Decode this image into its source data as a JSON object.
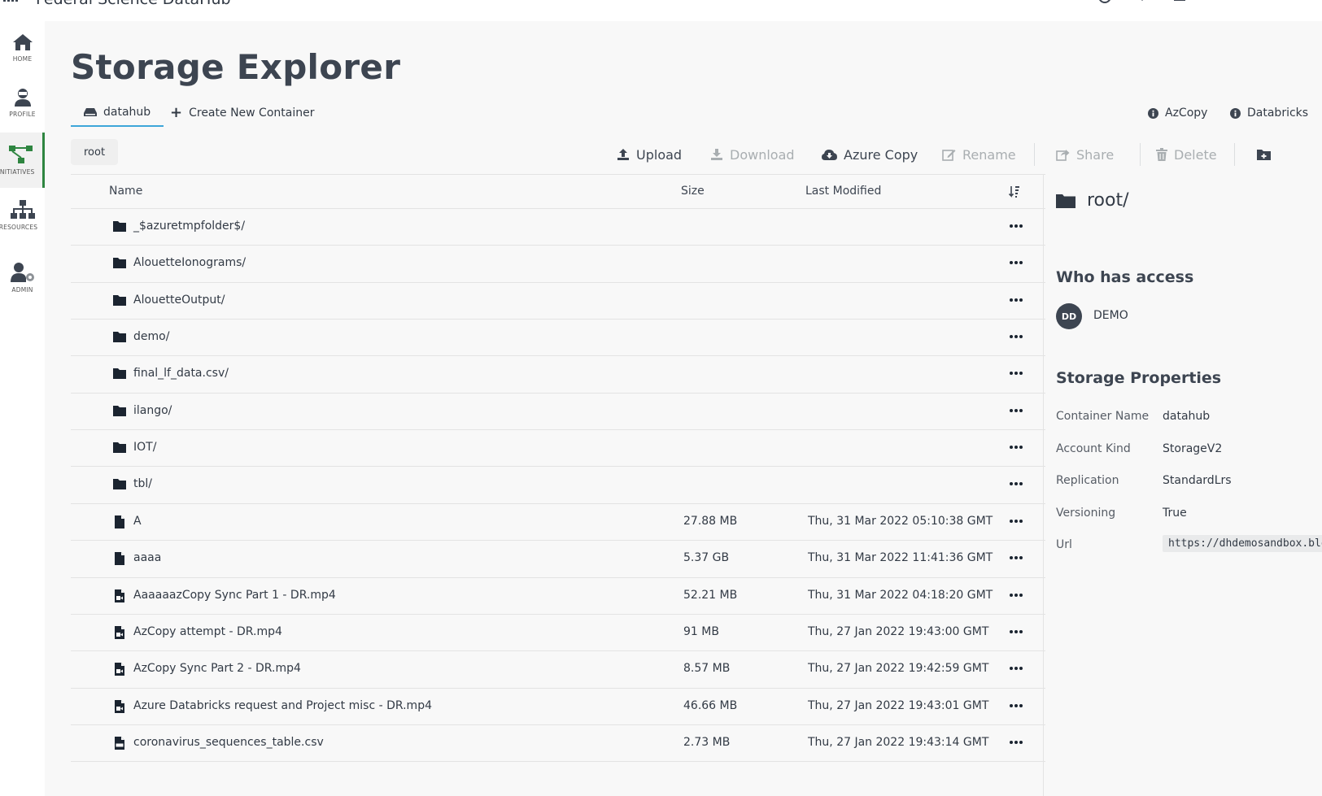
{
  "app": {
    "title": "Federal Science DataHub"
  },
  "sidebar": {
    "items": [
      {
        "label": "HOME"
      },
      {
        "label": "PROFILE"
      },
      {
        "label": "INITIATIVES"
      },
      {
        "label": "RESOURCES"
      },
      {
        "label": "ADMIN"
      }
    ],
    "active_index": 2
  },
  "page": {
    "title": "Storage Explorer"
  },
  "tabs": {
    "container": "datahub",
    "create": "Create New Container",
    "azcopy": "AzCopy",
    "databricks": "Databricks"
  },
  "breadcrumb": {
    "path": "root"
  },
  "toolbar": {
    "upload": "Upload",
    "download": "Download",
    "azure_copy": "Azure Copy",
    "rename": "Rename",
    "share": "Share",
    "delete": "Delete"
  },
  "table": {
    "columns": {
      "name": "Name",
      "size": "Size",
      "modified": "Last Modified"
    },
    "rows": [
      {
        "type": "folder",
        "name": "_$azuretmpfolder$/",
        "size": "",
        "modified": ""
      },
      {
        "type": "folder",
        "name": "AlouetteIonograms/",
        "size": "",
        "modified": ""
      },
      {
        "type": "folder",
        "name": "AlouetteOutput/",
        "size": "",
        "modified": ""
      },
      {
        "type": "folder",
        "name": "demo/",
        "size": "",
        "modified": ""
      },
      {
        "type": "folder",
        "name": "final_lf_data.csv/",
        "size": "",
        "modified": ""
      },
      {
        "type": "folder",
        "name": "ilango/",
        "size": "",
        "modified": ""
      },
      {
        "type": "folder",
        "name": "IOT/",
        "size": "",
        "modified": ""
      },
      {
        "type": "folder",
        "name": "tbl/",
        "size": "",
        "modified": ""
      },
      {
        "type": "file",
        "name": "A",
        "size": "27.88 MB",
        "modified": "Thu, 31 Mar 2022 05:10:38 GMT"
      },
      {
        "type": "file",
        "name": "aaaa",
        "size": "5.37 GB",
        "modified": "Thu, 31 Mar 2022 11:41:36 GMT"
      },
      {
        "type": "video",
        "name": "AaaaaazCopy Sync Part 1 - DR.mp4",
        "size": "52.21 MB",
        "modified": "Thu, 31 Mar 2022 04:18:20 GMT"
      },
      {
        "type": "video",
        "name": "AzCopy attempt - DR.mp4",
        "size": "91 MB",
        "modified": "Thu, 27 Jan 2022 19:43:00 GMT"
      },
      {
        "type": "video",
        "name": "AzCopy Sync Part 2 - DR.mp4",
        "size": "8.57 MB",
        "modified": "Thu, 27 Jan 2022 19:42:59 GMT"
      },
      {
        "type": "video",
        "name": "Azure Databricks request and Project misc - DR.mp4",
        "size": "46.66 MB",
        "modified": "Thu, 27 Jan 2022 19:43:01 GMT"
      },
      {
        "type": "csv",
        "name": "coronavirus_sequences_table.csv",
        "size": "2.73 MB",
        "modified": "Thu, 27 Jan 2022 19:43:14 GMT"
      }
    ]
  },
  "details": {
    "title": "root/",
    "access_heading": "Who has access",
    "access_user": {
      "initials": "DD",
      "name": "DEMO"
    },
    "props_heading": "Storage Properties",
    "props": [
      {
        "key": "Container Name",
        "value": "datahub"
      },
      {
        "key": "Account Kind",
        "value": "StorageV2"
      },
      {
        "key": "Replication",
        "value": "StandardLrs"
      },
      {
        "key": "Versioning",
        "value": "True"
      }
    ],
    "url_key": "Url",
    "url_value": "https://dhdemosandbox.blob.core.windows.net/datahub"
  },
  "colors": {
    "accent_tab": "#3ea6d9",
    "active_nav": "#2e8540",
    "text": "#323a45",
    "disabled": "#a9aeb1"
  }
}
